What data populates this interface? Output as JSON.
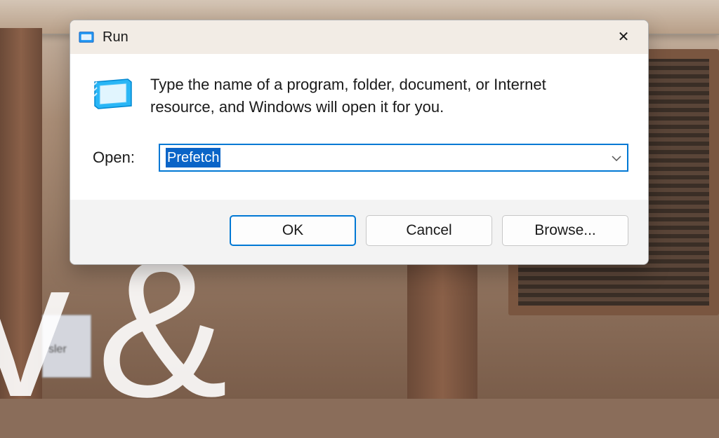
{
  "dialog": {
    "title": "Run",
    "description": "Type the name of a program, folder, document, or Internet resource, and Windows will open it for you.",
    "open_label": "Open:",
    "input_value": "Prefetch",
    "buttons": {
      "ok": "OK",
      "cancel": "Cancel",
      "browse": "Browse..."
    }
  },
  "background": {
    "overlay": "v &",
    "sign_blur": "sler"
  },
  "colors": {
    "accent": "#0078d4",
    "titlebar": "#f2ece5",
    "footer": "#f3f3f3"
  }
}
